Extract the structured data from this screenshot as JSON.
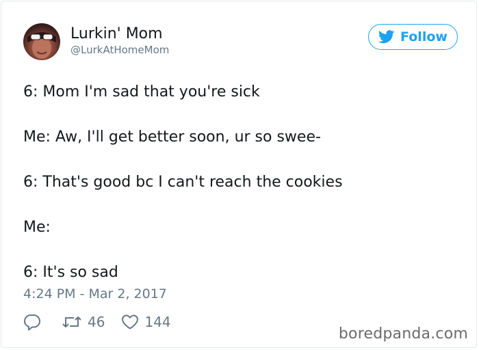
{
  "user": {
    "display_name": "Lurkin' Mom",
    "handle": "@LurkAtHomeMom"
  },
  "follow_button": {
    "label": "Follow",
    "icon": "twitter-bird-icon"
  },
  "tweet": {
    "lines": [
      "6: Mom I'm sad that you're sick",
      "Me: Aw, I'll get better soon, ur so swee-",
      "6: That's good bc I can't reach the cookies",
      "Me:",
      "6: It's so sad"
    ],
    "timestamp": "4:24 PM - Mar 2, 2017"
  },
  "actions": {
    "reply_icon": "reply-bubble-icon",
    "retweet_icon": "retweet-icon",
    "retweet_count": "46",
    "like_icon": "heart-icon",
    "like_count": "144"
  },
  "watermark": "boredpanda.com",
  "colors": {
    "accent": "#1da1f2",
    "secondary_text": "#657786",
    "primary_text": "#14171a",
    "border": "#e1e8ed"
  }
}
